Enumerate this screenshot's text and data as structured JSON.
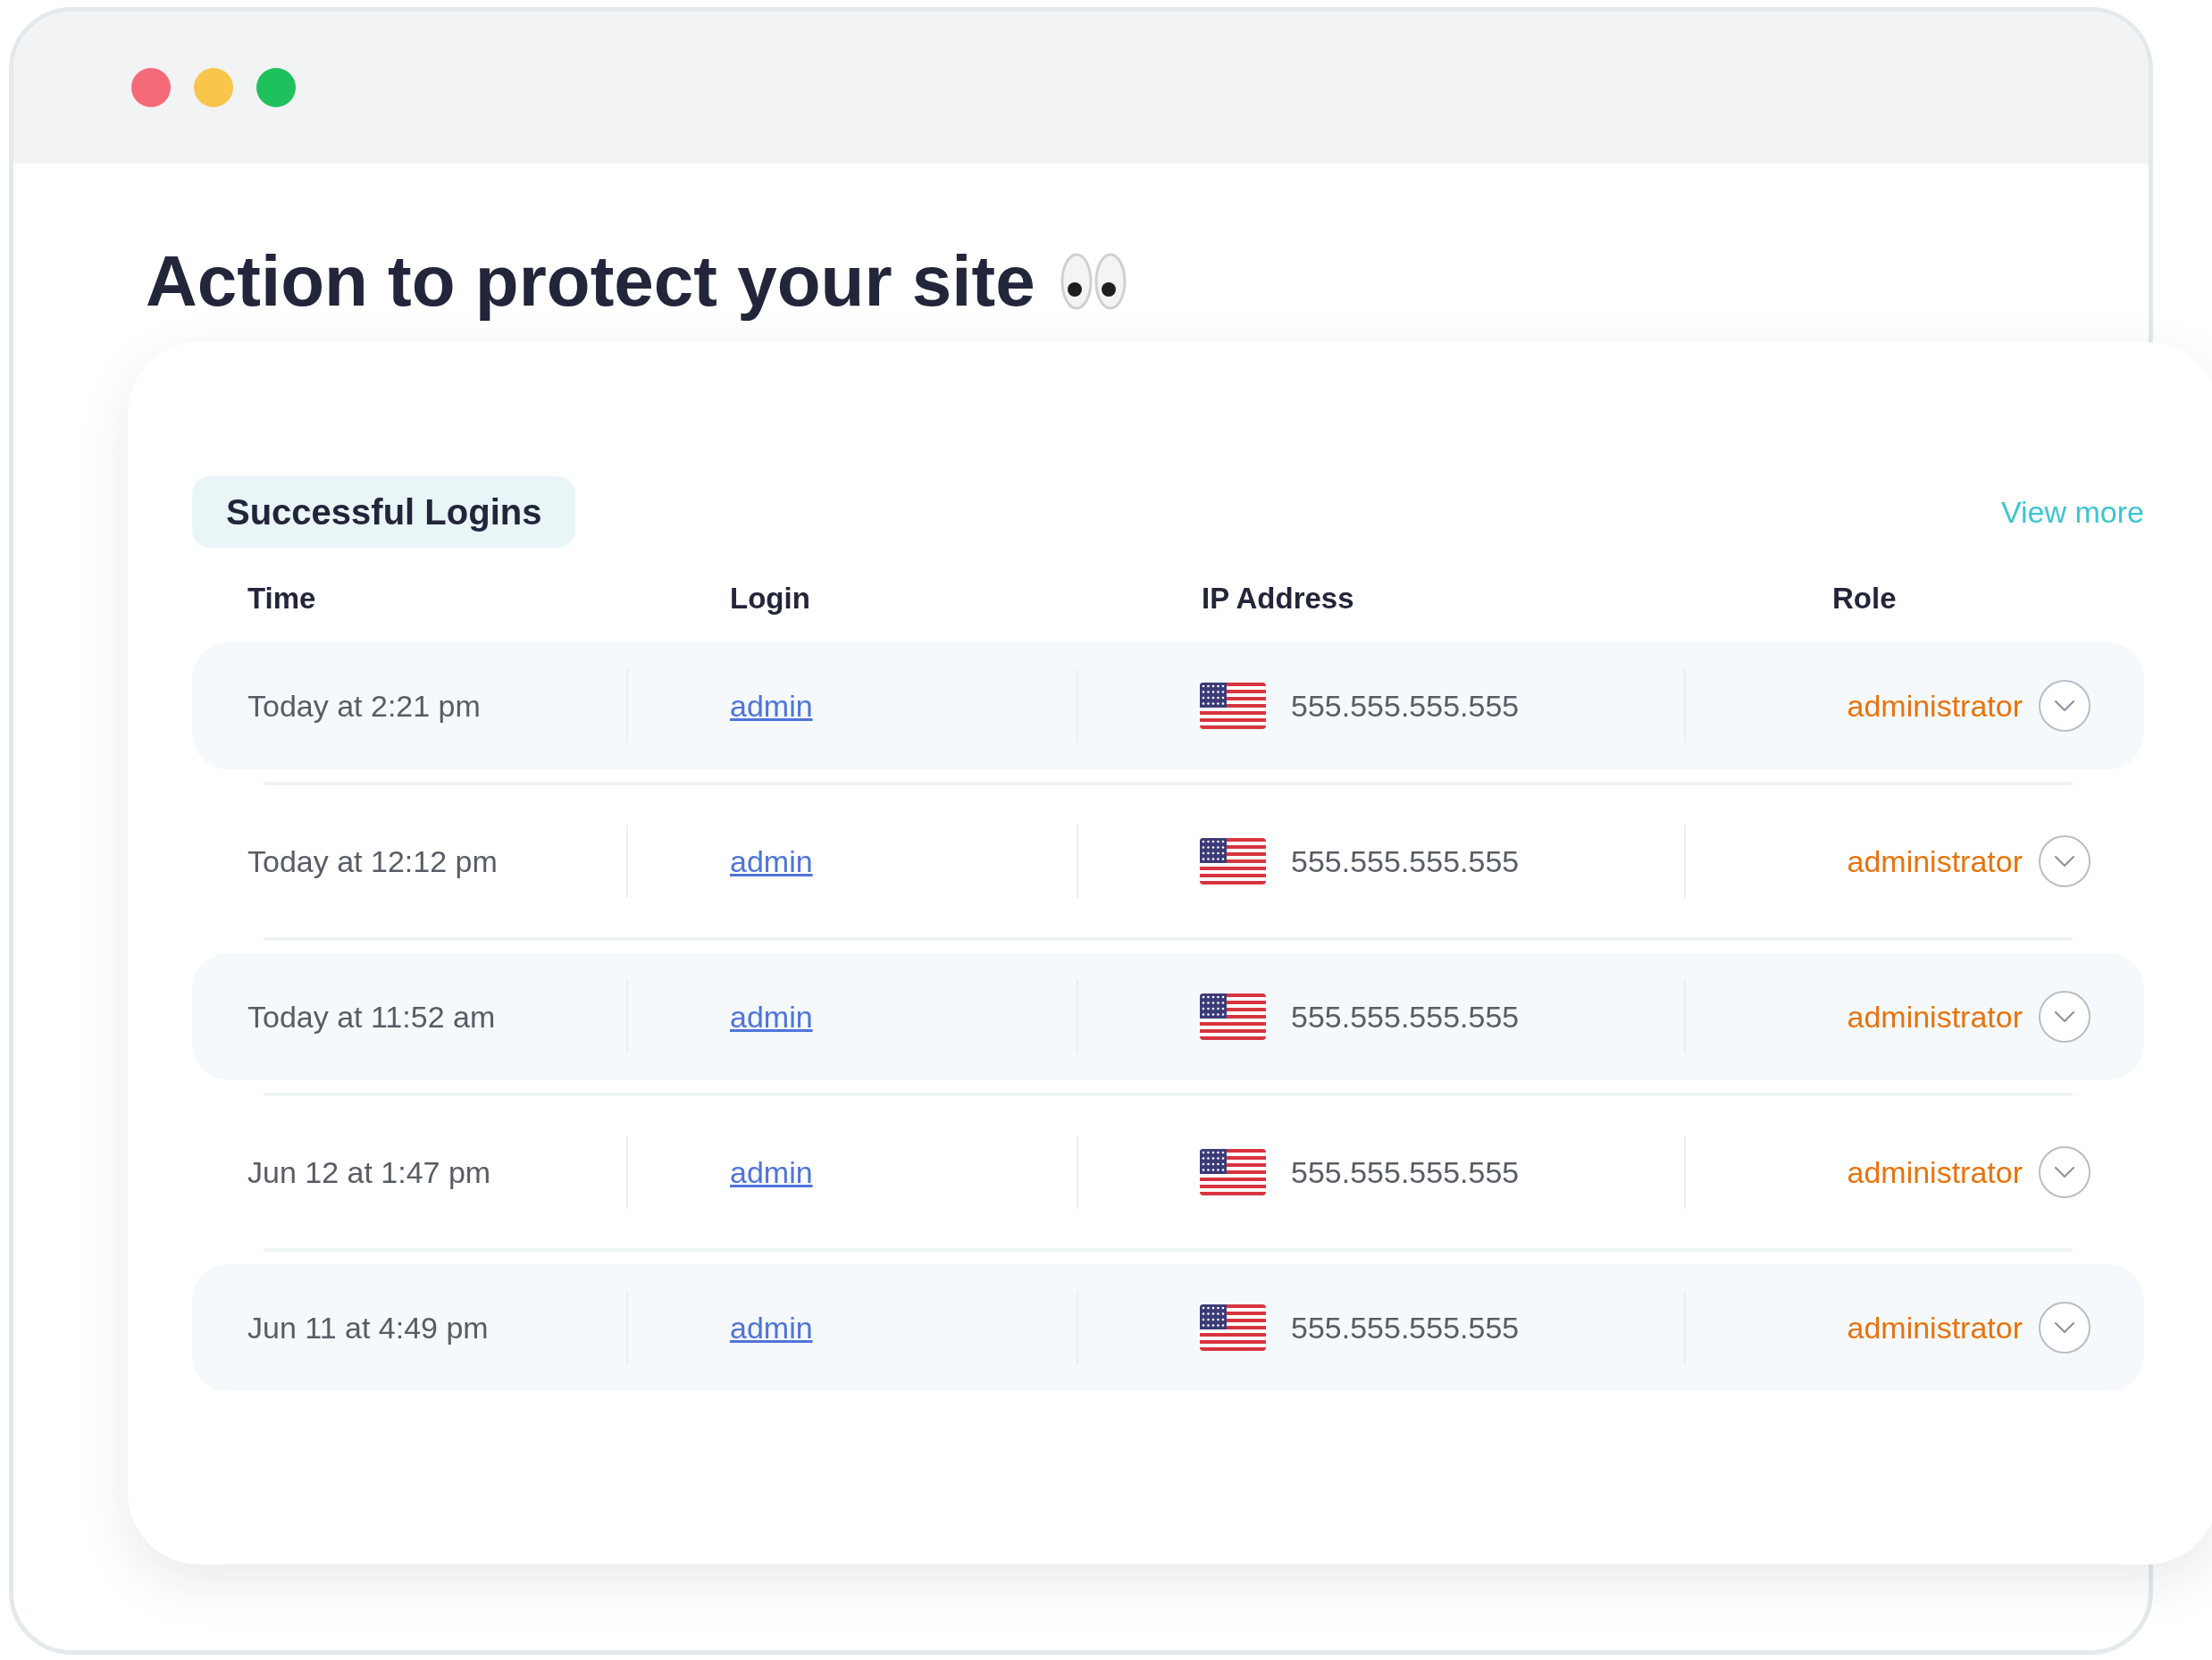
{
  "heading": "Action to protect your site",
  "panel": {
    "title": "Successful Logins",
    "view_more": "View more",
    "columns": [
      "Time",
      "Login",
      "IP Address",
      "Role"
    ],
    "rows": [
      {
        "time": "Today at 2:21 pm",
        "login": "admin",
        "ip": "555.555.555.555",
        "role": "administrator"
      },
      {
        "time": "Today at 12:12 pm",
        "login": "admin",
        "ip": "555.555.555.555",
        "role": "administrator"
      },
      {
        "time": "Today at 11:52 am",
        "login": "admin",
        "ip": "555.555.555.555",
        "role": "administrator"
      },
      {
        "time": "Jun 12 at 1:47 pm",
        "login": "admin",
        "ip": "555.555.555.555",
        "role": "administrator"
      },
      {
        "time": "Jun 11 at 4:49 pm",
        "login": "admin",
        "ip": "555.555.555.555",
        "role": "administrator"
      }
    ]
  }
}
